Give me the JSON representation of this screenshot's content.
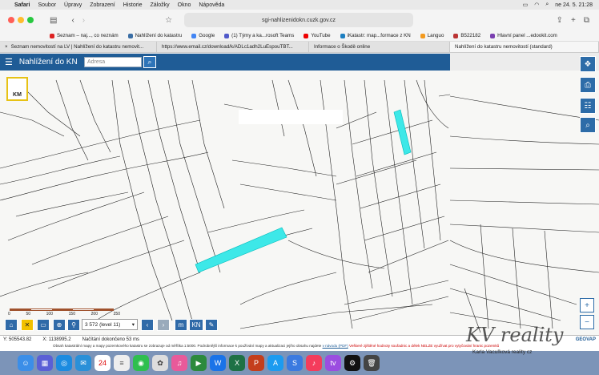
{
  "menubar": {
    "apple": "",
    "items": [
      "Safari",
      "Soubor",
      "Úpravy",
      "Zobrazení",
      "Historie",
      "Záložky",
      "Okno",
      "Nápověda"
    ],
    "clock": "ne 24. 5.  21:28"
  },
  "toolbar": {
    "address": "sgi-nahlizenidokn.cuzk.gov.cz"
  },
  "bookmarks": [
    {
      "label": "Seznam – naj..., co neznám",
      "color": "#d22"
    },
    {
      "label": "Nahlížení do katastru",
      "color": "#3a6ea5"
    },
    {
      "label": "Google",
      "color": "#4285f4"
    },
    {
      "label": "(1) Týmy a ka...rosoft Teams",
      "color": "#5059c9"
    },
    {
      "label": "YouTube",
      "color": "#e00"
    },
    {
      "label": "iKatastr: map...formace z KN",
      "color": "#1d7fc1"
    },
    {
      "label": "Languo",
      "color": "#f39a1e"
    },
    {
      "label": "B522182",
      "color": "#b33"
    },
    {
      "label": "Hlavní panel ...edookit.com",
      "color": "#7a3fb0"
    }
  ],
  "tabs": [
    {
      "label": "Seznam nemovitostí na LV | Nahlížení do katastru nemovit...",
      "active": false
    },
    {
      "label": "https://www.email.cz/download/k/ADLc1adh2LuEspouTBT...",
      "active": false
    },
    {
      "label": "Informace o Škodě online",
      "active": false
    },
    {
      "label": "Nahlížení do katastru nemovitostí (standard)",
      "active": true
    }
  ],
  "app": {
    "title": "Nahlížení do KN",
    "search_placeholder": "Adresa",
    "km_label": "KM"
  },
  "scale": {
    "ticks": [
      "0",
      "50",
      "100",
      "150",
      "200",
      "250"
    ],
    "level": "3 572 (level 11)"
  },
  "mapbuttons": [
    "m",
    "KN"
  ],
  "status": {
    "y": "Y: 505543.82",
    "x": "X: 1138995.2",
    "loading": "Načítání dokončeno 53 ms",
    "geovap": "GEOVAP"
  },
  "disclaimer": {
    "text": "Obsah katastrální mapy a mapy pozemkového katastru se zobrazuje od měřítka 1:5000. Podrobnější informace k používání mapy a aktualizaci jejího obsahu najdete",
    "link": "v návodu (PDF)",
    "warning": "Veškeré zjištěné hodnoty souřadnic a délek NELZE využívat pro vytyčování hranic pozemků"
  },
  "dock": {
    "calendar_day": "24"
  },
  "watermark": {
    "title": "KV reality",
    "sub": "Karla Vacuľková reality cz"
  }
}
